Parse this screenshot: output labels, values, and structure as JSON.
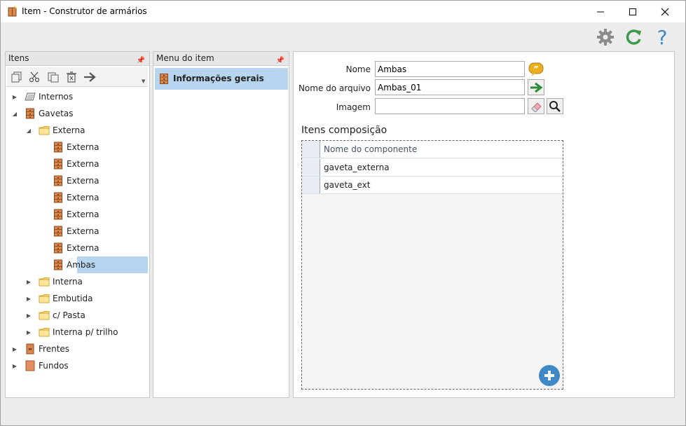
{
  "window": {
    "title": "Item - Construtor de armários",
    "minimize": "—",
    "maximize": "☐",
    "close": "✕"
  },
  "toolbar_top": {
    "icons": [
      "gear-icon",
      "refresh-icon",
      "help-icon"
    ],
    "help_glyph": "?"
  },
  "itens_panel": {
    "header": "Itens",
    "toolbar_icons": [
      "copy-icon",
      "cut-icon",
      "paste-icon",
      "delete-icon",
      "arrow-right-icon"
    ],
    "tree": [
      {
        "label": "Internos",
        "level": 0,
        "expander": "collapsed",
        "icon": "sheet-icon"
      },
      {
        "label": "Gavetas",
        "level": 0,
        "expander": "expanded",
        "icon": "drawer-icon"
      },
      {
        "label": "Externa",
        "level": 1,
        "expander": "expanded",
        "icon": "folder-icon"
      },
      {
        "label": "Externa",
        "level": 2,
        "expander": "none",
        "icon": "drawer-icon"
      },
      {
        "label": "Externa",
        "level": 2,
        "expander": "none",
        "icon": "drawer-icon"
      },
      {
        "label": "Externa",
        "level": 2,
        "expander": "none",
        "icon": "drawer-icon"
      },
      {
        "label": "Externa",
        "level": 2,
        "expander": "none",
        "icon": "drawer-icon"
      },
      {
        "label": "Externa",
        "level": 2,
        "expander": "none",
        "icon": "drawer-icon"
      },
      {
        "label": "Externa",
        "level": 2,
        "expander": "none",
        "icon": "drawer-icon"
      },
      {
        "label": "Externa",
        "level": 2,
        "expander": "none",
        "icon": "drawer-icon"
      },
      {
        "label": "Ambas",
        "level": 2,
        "expander": "none",
        "icon": "drawer-icon",
        "selected": true
      },
      {
        "label": "Interna",
        "level": 1,
        "expander": "collapsed",
        "icon": "folder-icon"
      },
      {
        "label": "Embutida",
        "level": 1,
        "expander": "collapsed",
        "icon": "folder-icon"
      },
      {
        "label": "c/ Pasta",
        "level": 1,
        "expander": "collapsed",
        "icon": "folder-icon"
      },
      {
        "label": "Interna p/ trilho",
        "level": 1,
        "expander": "collapsed",
        "icon": "folder-icon"
      },
      {
        "label": "Frentes",
        "level": 0,
        "expander": "collapsed",
        "icon": "door-icon"
      },
      {
        "label": "Fundos",
        "level": 0,
        "expander": "collapsed",
        "icon": "panel-icon"
      }
    ]
  },
  "menu_panel": {
    "header": "Menu do item",
    "items": [
      {
        "label": "Informações gerais",
        "selected": true
      }
    ]
  },
  "form": {
    "nome_label": "Nome",
    "nome_value": "Ambas",
    "arquivo_label": "Nome do arquivo",
    "arquivo_value": "Ambas_01",
    "imagem_label": "Imagem",
    "imagem_value": ""
  },
  "grid": {
    "title": "Itens composição",
    "column_header": "Nome do componente",
    "rows": [
      "gaveta_externa",
      "gaveta_ext"
    ]
  },
  "colors": {
    "selection": "#b7d5ee",
    "folder": "#f6d77a",
    "drawer": "#d9874a",
    "accent_blue": "#3f89c6",
    "green": "#3c9a4a"
  }
}
